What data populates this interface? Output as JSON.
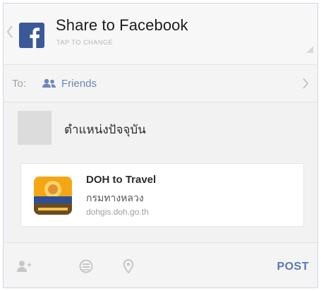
{
  "header": {
    "title": "Share to Facebook",
    "subtitle": "TAP TO CHANGE"
  },
  "audience": {
    "to_label": "To:",
    "selected": "Friends"
  },
  "compose": {
    "status_text": "ตำแหน่งปัจจุบัน"
  },
  "link_card": {
    "title": "DOH to Travel",
    "subtitle": "กรมทางหลวง",
    "domain": "dohgis.doh.go.th",
    "icon_label": "DOH to Travel"
  },
  "toolbar": {
    "post_label": "POST"
  },
  "colors": {
    "facebook_blue": "#3b5998",
    "link_blue": "#6d86b9",
    "post_blue": "#5b78b2"
  }
}
